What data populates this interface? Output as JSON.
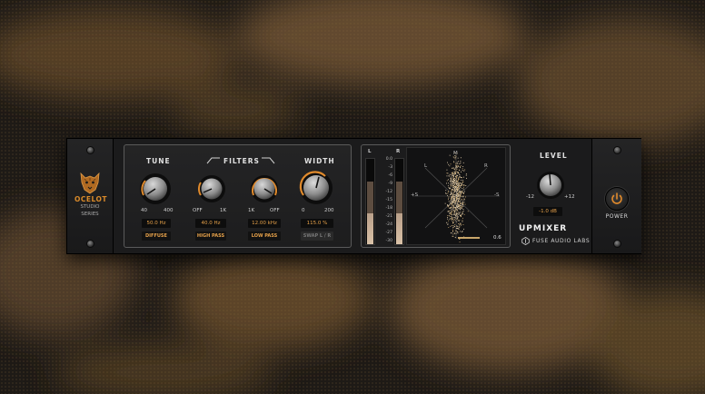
{
  "brand": {
    "line1": "OCELOT",
    "line2": "STUDIO",
    "line3": "SERIES"
  },
  "tune": {
    "label": "TUNE",
    "min": "40",
    "max": "400",
    "value": "50.0 Hz",
    "button": "DIFFUSE"
  },
  "filters": {
    "label": "FILTERS",
    "highpass": {
      "min": "OFF",
      "max": "1K",
      "value": "40.0 Hz",
      "button": "HIGH PASS"
    },
    "lowpass": {
      "min": "1K",
      "max": "OFF",
      "value": "12.00 kHz",
      "button": "LOW PASS"
    }
  },
  "width": {
    "label": "WIDTH",
    "min": "0",
    "max": "200",
    "value": "115.0 %",
    "button": "SWAP L / R"
  },
  "meters": {
    "left_label": "L",
    "right_label": "R",
    "scale": [
      "0.0",
      "-3",
      "-6",
      "-9",
      "-12",
      "-15",
      "-18",
      "-21",
      "-24",
      "-27",
      "-30"
    ]
  },
  "scope": {
    "m": "M",
    "l": "L",
    "r": "R",
    "plus_s": "+S",
    "minus_s": "-S",
    "correlation": "0.6"
  },
  "level": {
    "label": "LEVEL",
    "min": "-12",
    "max": "+12",
    "value": "-1.0 dB"
  },
  "product": {
    "title": "UPMIXER",
    "maker": "FUSE AUDIO LABS"
  },
  "power": {
    "label": "POWER"
  },
  "colors": {
    "accent": "#e08a2c",
    "value_text": "#e6a14a",
    "panel": "#1b1b1c"
  }
}
